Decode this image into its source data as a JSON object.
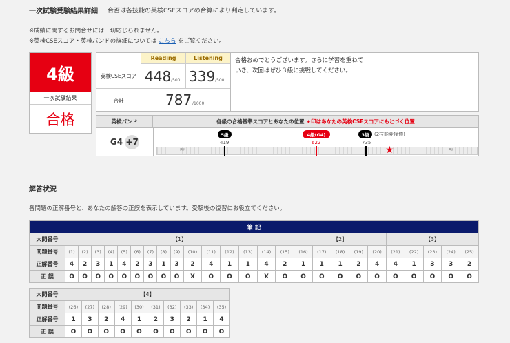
{
  "header": {
    "title": "一次試験受験結果詳細",
    "subtitle": "合否は各技能の英検CSEスコアの合算により判定しています。"
  },
  "notes": {
    "line1": "※成績に関するお問合せには一切応じられません。",
    "line2_pre": "※英検CSEスコア・英検バンドの詳細については",
    "line2_link": "こちら",
    "line2_post": "をご覧ください。"
  },
  "grade": {
    "level": "4級",
    "label": "一次試験結果",
    "result": "合格"
  },
  "scores": {
    "row_label": "英検CSEスコア",
    "total_label": "合計",
    "reading": {
      "label": "Reading",
      "value": "448",
      "max": "/500"
    },
    "listening": {
      "label": "Listening",
      "value": "339",
      "max": "/500"
    },
    "total": {
      "value": "787",
      "max": "/1000"
    }
  },
  "message": "合格おめでとうございます。さらに学習を重ねていき、次回はぜひ３級に挑戦してください。",
  "band": {
    "label": "英検バンド",
    "value": "G4",
    "offset": "+7",
    "header": "各級の合格基準スコアとあなたの位置",
    "note": "★印はあなたの英検CSEスコアにもとづく位置",
    "markers": [
      {
        "name": "5級",
        "score": "419"
      },
      {
        "name": "4級(G4)",
        "score": "622"
      },
      {
        "name": "3級",
        "score": "735",
        "extra": "(2技能変換値)"
      }
    ],
    "star": "★",
    "break_mark": "≈"
  },
  "answers": {
    "title": "解答状況",
    "description": "各問題の正解番号と、あなたの解答の正誤を表示しています。受験後の復習にお役立てください。",
    "section": "筆 記",
    "row_labels": {
      "group": "大問番号",
      "question": "問題番号",
      "correct": "正解番号",
      "result": "正 誤"
    },
    "groups1": [
      "【1】",
      "【2】",
      "【3】"
    ],
    "groups2": [
      "【4】"
    ],
    "questions1": [
      "(1)",
      "(2)",
      "(3)",
      "(4)",
      "(5)",
      "(6)",
      "(7)",
      "(8)",
      "(9)",
      "(10)",
      "(11)",
      "(12)",
      "(13)",
      "(14)",
      "(15)",
      "(16)",
      "(17)",
      "(18)",
      "(19)",
      "(20)",
      "(21)",
      "(22)",
      "(23)",
      "(24)",
      "(25)"
    ],
    "correct1": [
      "4",
      "2",
      "3",
      "1",
      "4",
      "2",
      "3",
      "1",
      "3",
      "2",
      "4",
      "1",
      "1",
      "4",
      "2",
      "1",
      "1",
      "1",
      "2",
      "4",
      "4",
      "1",
      "3",
      "3",
      "2"
    ],
    "result1": [
      "O",
      "O",
      "O",
      "O",
      "O",
      "O",
      "O",
      "O",
      "O",
      "X",
      "O",
      "O",
      "O",
      "X",
      "O",
      "O",
      "O",
      "O",
      "O",
      "O",
      "O",
      "O",
      "O",
      "O",
      "O"
    ],
    "questions2": [
      "(26)",
      "(27)",
      "(28)",
      "(29)",
      "(30)",
      "(31)",
      "(32)",
      "(33)",
      "(34)",
      "(35)"
    ],
    "correct2": [
      "1",
      "3",
      "2",
      "4",
      "1",
      "2",
      "3",
      "2",
      "1",
      "4"
    ],
    "result2": [
      "O",
      "O",
      "O",
      "O",
      "O",
      "O",
      "O",
      "O",
      "O",
      "O"
    ]
  }
}
